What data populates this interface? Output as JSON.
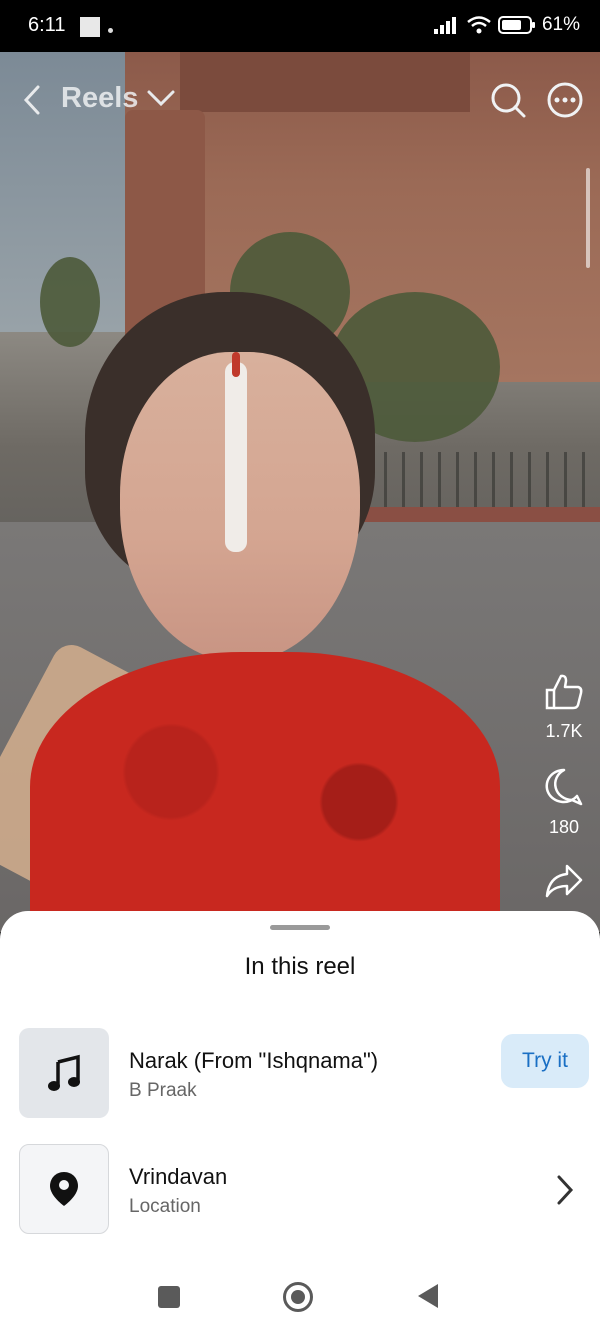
{
  "status_bar": {
    "time": "6:11",
    "battery": "61%"
  },
  "header": {
    "title": "Reels"
  },
  "rail": {
    "likes": "1.7K",
    "comments": "180"
  },
  "sheet": {
    "title": "In this reel",
    "items": [
      {
        "title": "Narak (From \"Ishqnama\")",
        "subtitle": "B Praak",
        "action": "Try it",
        "icon": "music-note-icon"
      },
      {
        "title": "Vrindavan",
        "subtitle": "Location",
        "icon": "location-pin-icon"
      }
    ]
  },
  "colors": {
    "accent": "#1a6fc4",
    "try_bg": "#d9ebf9"
  }
}
